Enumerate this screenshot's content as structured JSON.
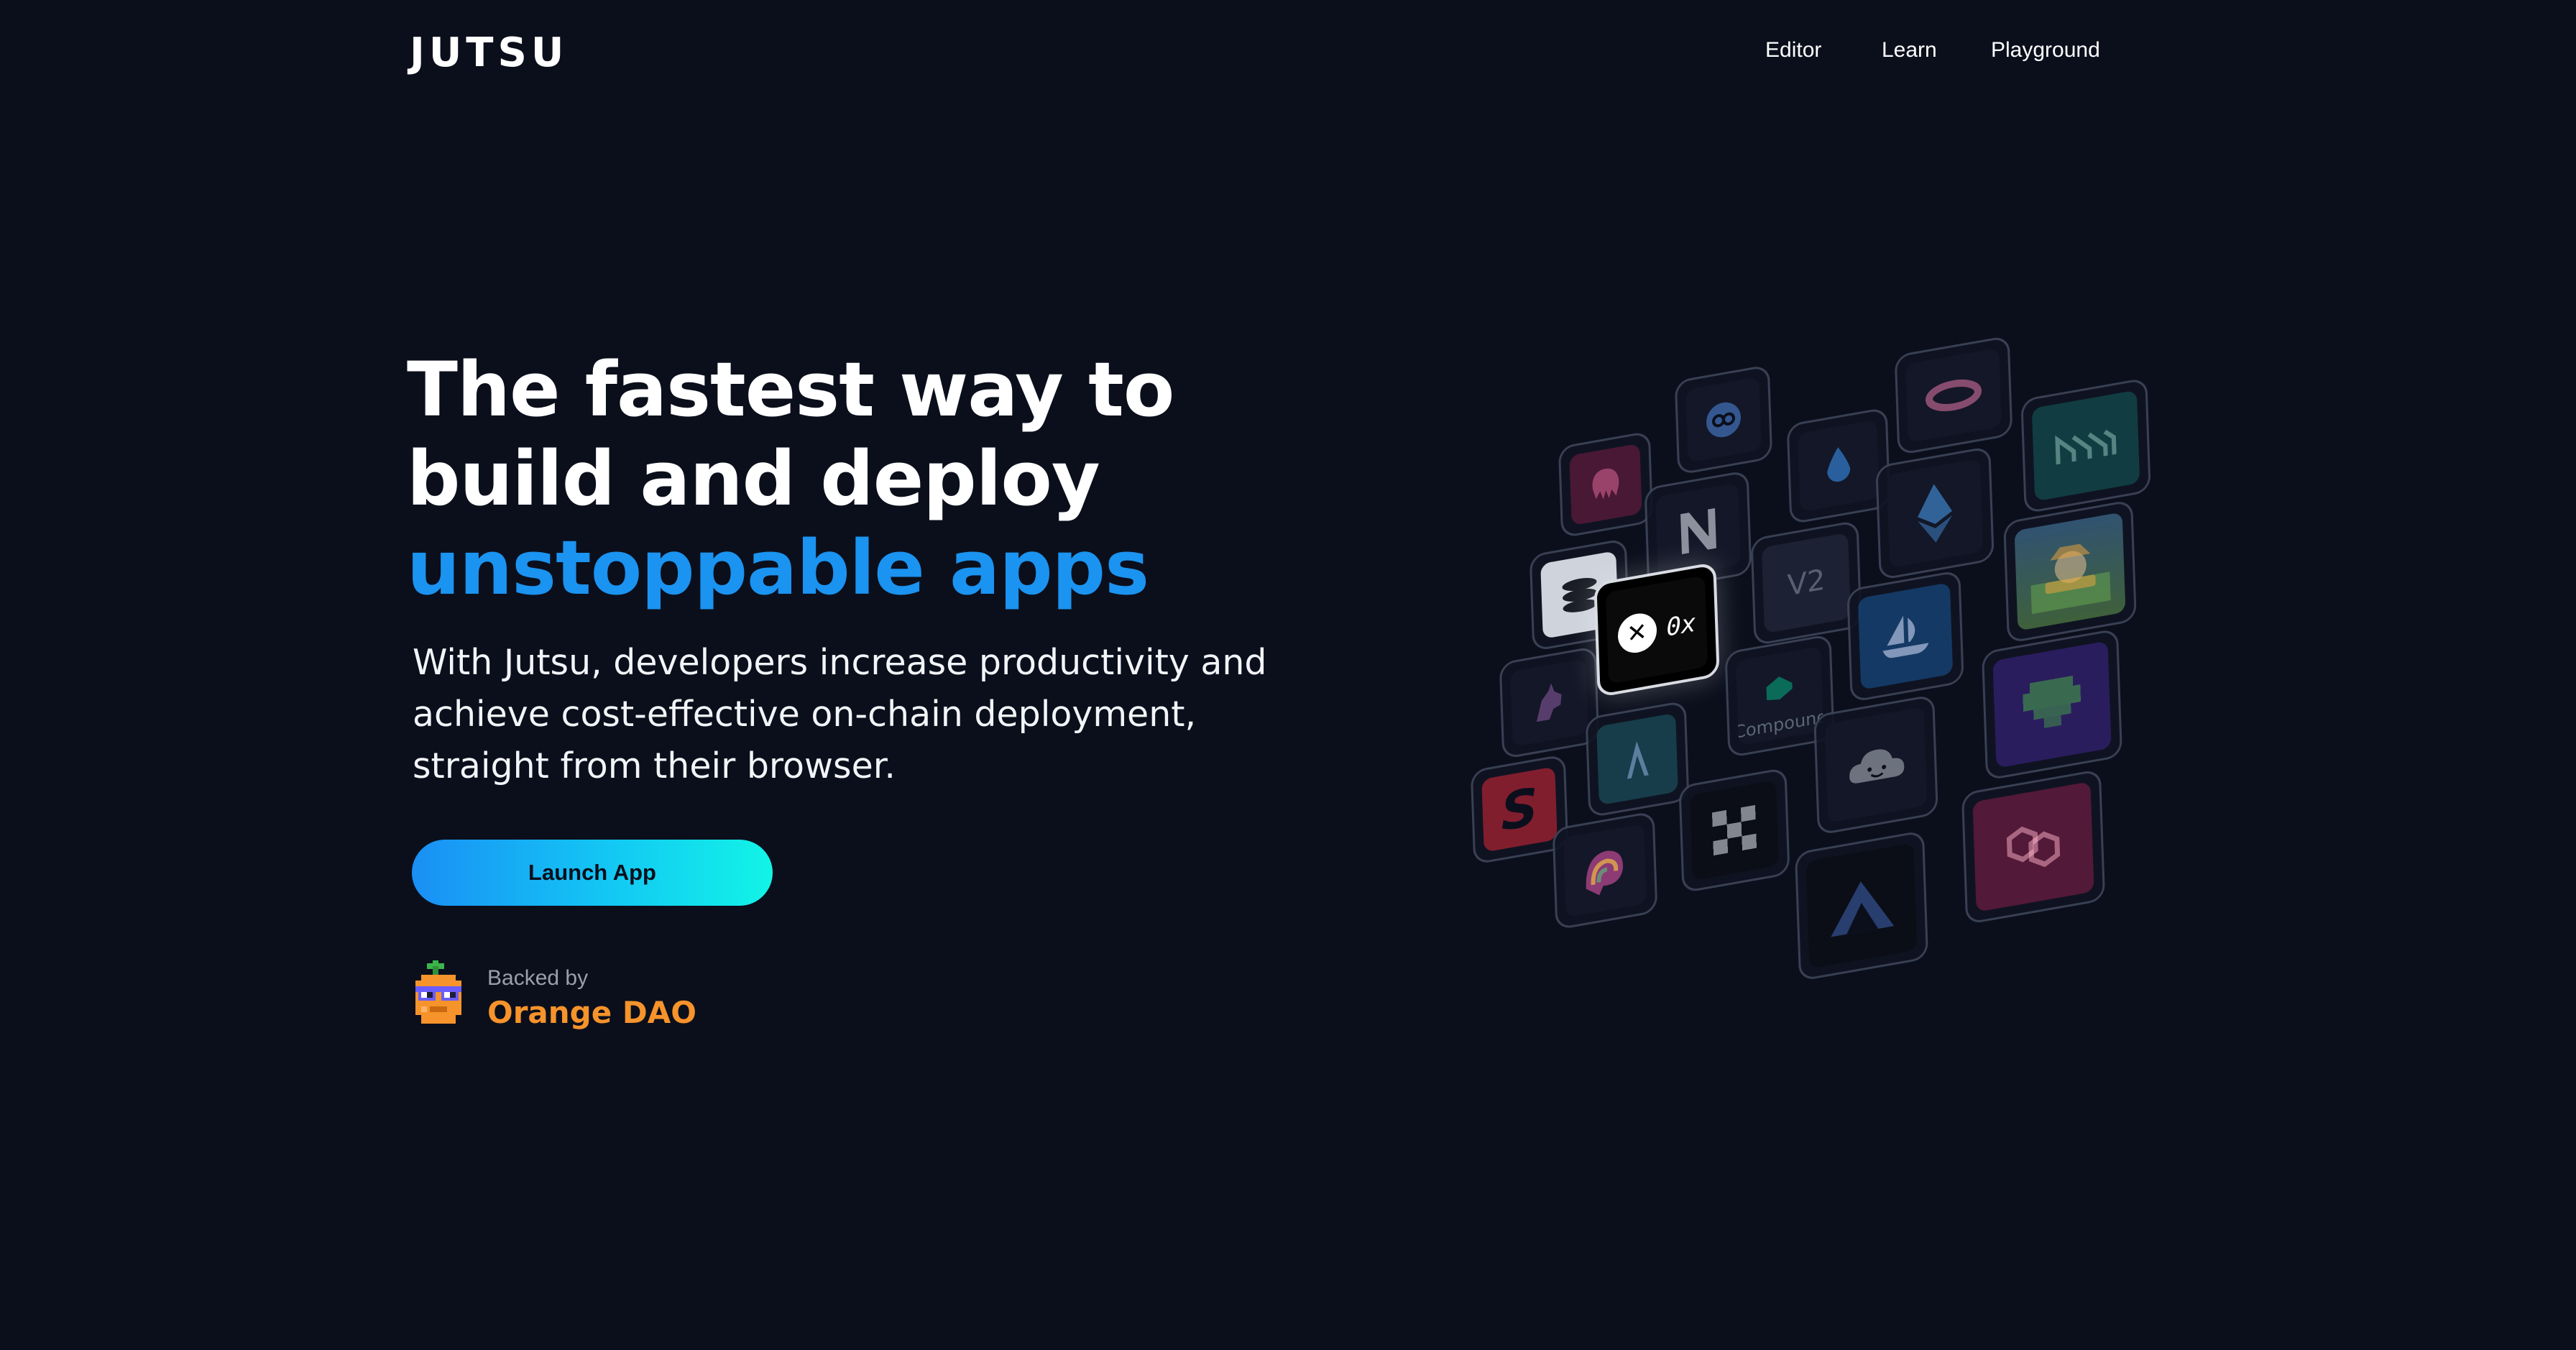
{
  "header": {
    "logo": "JUTSU",
    "nav": [
      "Editor",
      "Learn",
      "Playground"
    ]
  },
  "hero": {
    "title_lines": [
      "The fastest way to",
      "build and deploy"
    ],
    "title_accent": "unstoppable apps",
    "subtitle_lines": [
      "With Jutsu, developers increase productivity and",
      "achieve cost-effective on-chain deployment,",
      "straight from their browser."
    ],
    "cta": "Launch App",
    "backed_label": "Backed by",
    "backer_name": "Orange DAO"
  },
  "tiles": {
    "featured_label": "0x",
    "v2_label": "V2",
    "compound_label": "Compound",
    "icons": [
      "coinmarketcap-icon",
      "lido-icon",
      "orbit-icon",
      "maker-icon",
      "kraken-icon",
      "near-icon",
      "ethereum-icon",
      "stack-icon",
      "zero-x-icon",
      "v2-icon",
      "farmers-world-icon",
      "unicorn-icon",
      "compound-icon",
      "opensea-icon",
      "gem-icon",
      "aave-icon",
      "cloud-face-icon",
      "synthetix-icon",
      "rainbow-icon",
      "pixel-x-icon",
      "arbitrum-icon",
      "polygon-icon"
    ],
    "accent_colors": {
      "maker": "#1aab9b",
      "kraken": "#e0286c",
      "opensea": "#2081e2",
      "farmers": "#e6a23c",
      "gem": "#4b2aa8",
      "polygon": "#e0286c",
      "synthetix": "#e0283a",
      "aave": "#2ebac6",
      "lido": "#3d9aff"
    }
  },
  "colors": {
    "background": "#0b0f1c",
    "accent_blue": "#1b93f0",
    "button_gradient_start": "#1a8ff5",
    "button_gradient_end": "#12f4e6",
    "orange": "#f6932b"
  }
}
